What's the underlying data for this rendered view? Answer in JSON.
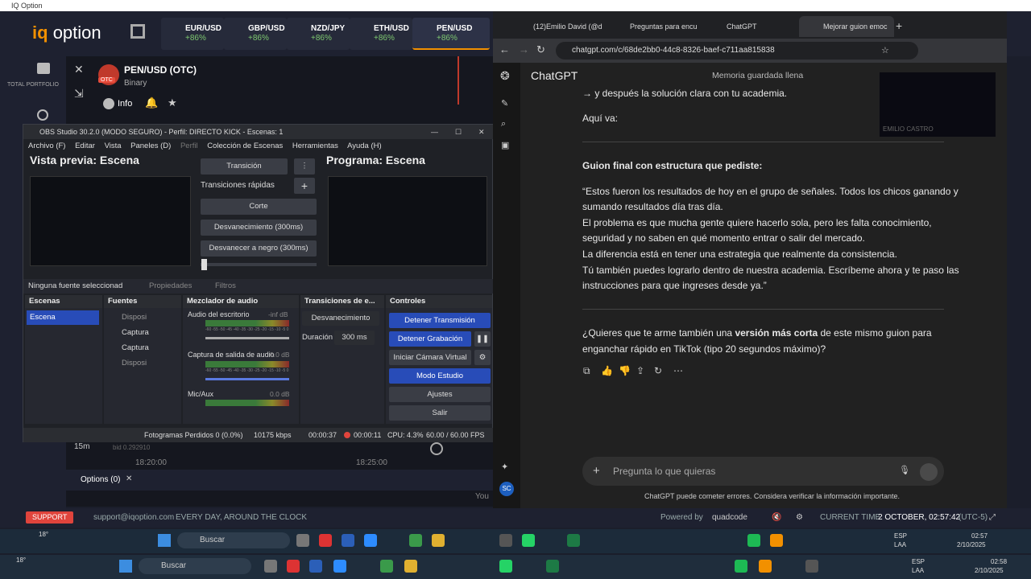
{
  "iq": {
    "window_title": "IQ Option",
    "logo_main": "iq",
    "logo_sub": "option",
    "assets": [
      {
        "name": "EUR/USD",
        "pct": "+86%"
      },
      {
        "name": "GBP/USD",
        "pct": "+86%"
      },
      {
        "name": "NZD/JPY",
        "pct": "+86%"
      },
      {
        "name": "ETH/USD",
        "pct": "+86%"
      },
      {
        "name": "PEN/USD",
        "pct": "+86%"
      }
    ],
    "total_portfolio": "TOTAL PORTFOLIO",
    "pair_title": "PEN/USD (OTC)",
    "pair_badge": "OTC",
    "pair_type": "Binary",
    "info_label": "Info",
    "timeframe": "15m",
    "bid": "bid 0.292910",
    "time_1": "18:20:00",
    "time_2": "18:25:00",
    "options_label": "Options (0)",
    "you_label": "You",
    "support_btn": "SUPPORT",
    "support_email": "support@iqoption.com",
    "support_hours": "EVERY DAY, AROUND THE CLOCK",
    "powered_by": "Powered by",
    "powered_brand": "quadcode",
    "current_time_label": "CURRENT TIME:",
    "current_time_value": "2 OCTOBER, 02:57:42",
    "timezone": "(UTC-5)"
  },
  "obs": {
    "title": "OBS Studio 30.2.0 (MODO SEGURO) - Perfil: DIRECTO KICK - Escenas: 1",
    "menu": [
      "Archivo (F)",
      "Editar",
      "Vista",
      "Paneles (D)",
      "Perfil",
      "Colección de Escenas",
      "Herramientas",
      "Ayuda (H)"
    ],
    "preview_title": "Vista previa: Escena",
    "program_title": "Programa: Escena",
    "transition_btn": "Transición",
    "quick_transitions": "Transiciones rápidas",
    "cut": "Corte",
    "fade": "Desvanecimiento (300ms)",
    "fade_black": "Desvanecer a negro (300ms)",
    "no_source": "Ninguna fuente seleccionad",
    "properties": "Propiedades",
    "filters": "Filtros",
    "docks": {
      "scenes": "Escenas",
      "sources": "Fuentes",
      "mixer": "Mezclador de audio",
      "transitions": "Transiciones de e...",
      "controls": "Controles"
    },
    "scene_item": "Escena",
    "sources": [
      "Disposi",
      "Captura",
      "Captura",
      "Disposi"
    ],
    "mixer": [
      {
        "name": "Audio del escritorio",
        "db": "-inf dB"
      },
      {
        "name": "Captura de salida de audio",
        "db": "0.0 dB"
      },
      {
        "name": "Mic/Aux",
        "db": "0.0 dB"
      }
    ],
    "meter_ticks": "-60 -55 -50 -45 -40 -35 -30 -25 -20 -15 -10 -5 0",
    "transition_select": "Desvanecimiento",
    "duration_label": "Duración",
    "duration_value": "300 ms",
    "controls": {
      "stop_stream": "Detener Transmisión",
      "stop_rec": "Detener Grabación",
      "virtual_cam": "Iniciar Cámara Virtual",
      "studio": "Modo Estudio",
      "settings": "Ajustes",
      "exit": "Salir"
    },
    "status": {
      "dropped": "Fotogramas Perdidos 0 (0.0%)",
      "kbps": "10175 kbps",
      "stream_time": "00:00:37",
      "rec_time": "00:00:11",
      "cpu": "CPU: 4.3%",
      "fps": "60.00 / 60.00 FPS"
    }
  },
  "browser": {
    "tabs": [
      "(12)Emilio David (@d",
      "Preguntas para encu",
      "ChatGPT",
      "Mejorar guion emoc"
    ],
    "url": "chatgpt.com/c/68de2bb0-44c8-8326-baef-c711aa815838",
    "model": "ChatGPT",
    "memory_full": "Memoria guardada llena",
    "video_label": "EMILIO CASTRO",
    "line_intro": "→ y después la solución clara con tu academia.",
    "aqui_va": "Aquí va:",
    "heading": "Guion final con estructura que pediste:",
    "para": [
      "“Estos fueron los resultados de hoy en el grupo de señales. Todos los chicos ganando y",
      "sumando resultados día tras día.",
      "El problema es que mucha gente quiere hacerlo sola, pero les falta conocimiento,",
      "seguridad y no saben en qué momento entrar o salir del mercado.",
      "La diferencia está en tener una estrategia que realmente da consistencia.",
      "Tú también puedes lograrlo dentro de nuestra academia. Escríbeme ahora y te paso las",
      "instrucciones para que ingreses desde ya.”"
    ],
    "question_pre": "¿Quieres que te arme también una ",
    "question_bold": "versión más corta",
    "question_post": " de este mismo guion para",
    "question_line2": "enganchar rápido en TikTok (tipo 20 segundos máximo)?",
    "composer_placeholder": "Pregunta lo que quieras",
    "disclaimer": "ChatGPT puede cometer errores. Considera verificar la información importante.",
    "avatar_initials": "SC"
  },
  "taskbar1": {
    "temp": "18°",
    "search": "Buscar",
    "lang1": "ESP",
    "lang2": "LAA",
    "time": "02:57",
    "date": "2/10/2025"
  },
  "taskbar2": {
    "temp": "18°",
    "search": "Buscar",
    "lang1": "ESP",
    "lang2": "LAA",
    "time": "02:58",
    "date": "2/10/2025"
  },
  "colors": {
    "accent_blue": "#284cb8",
    "iq_orange": "#f29000",
    "green_pct": "#7ec870",
    "support_red": "#e0443c"
  }
}
